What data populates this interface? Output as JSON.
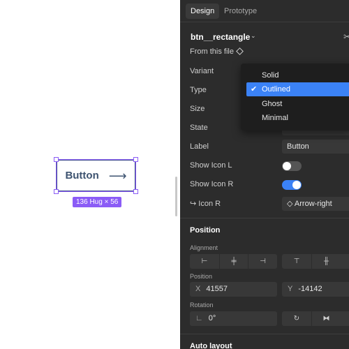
{
  "canvas": {
    "preview_button": {
      "label": "Button",
      "arrow": "⟶"
    },
    "size_badge": "136 Hug × 56"
  },
  "panel": {
    "tabs": [
      {
        "label": "Design",
        "active": true
      },
      {
        "label": "Prototype",
        "active": false
      }
    ],
    "component_name": "btn__rectangle",
    "component_caret": "⌄",
    "detach_icon": "✂",
    "source": "From this file",
    "properties": {
      "variant": {
        "label": "Variant"
      },
      "type": {
        "label": "Type"
      },
      "size": {
        "label": "Size"
      },
      "state": {
        "label": "State"
      },
      "label": {
        "label": "Label",
        "value": "Button"
      },
      "show_icon_l": {
        "label": "Show Icon L",
        "on": false
      },
      "show_icon_r": {
        "label": "Show Icon R",
        "on": true
      },
      "icon_r": {
        "label": "↪ Icon R",
        "value": "Arrow-right",
        "icon": "◇"
      }
    },
    "position_section": {
      "title": "Position",
      "alignment_label": "Alignment",
      "alignment_icons": [
        "align-left-icon",
        "align-center-h-icon",
        "align-right-icon",
        "align-top-icon",
        "align-center-v-icon"
      ],
      "alignment_glyphs": [
        "⊢",
        "╪",
        "⊣",
        "⊤",
        "╫"
      ],
      "position_label": "Position",
      "x_axis": "X",
      "x_value": "41557",
      "y_axis": "Y",
      "y_value": "-14142",
      "rotation_label": "Rotation",
      "rotation_icon": "∟",
      "rotation_value": "0°",
      "transform_glyphs": [
        "↻",
        "⧓"
      ]
    },
    "autolayout_title": "Auto layout"
  },
  "dropdown": {
    "items": [
      {
        "label": "Solid",
        "selected": false
      },
      {
        "label": "Outlined",
        "selected": true
      },
      {
        "label": "Ghost",
        "selected": false
      },
      {
        "label": "Minimal",
        "selected": false
      }
    ],
    "check": "✔"
  },
  "colors": {
    "selection": "#8b5cf6",
    "accent": "#3b82f6",
    "panel_bg": "#2c2c2c"
  }
}
